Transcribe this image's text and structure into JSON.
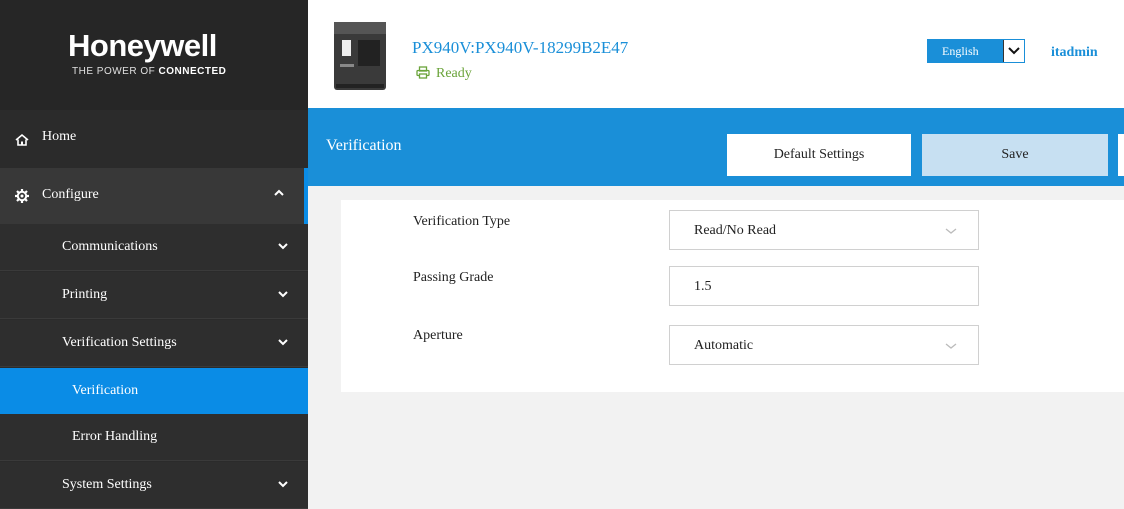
{
  "brand": {
    "name": "Honeywell",
    "tagline_a": "THE POWER OF ",
    "tagline_b": "CONNECTED"
  },
  "device": {
    "name": "PX940V:PX940V-18299B2E47",
    "status": "Ready"
  },
  "header": {
    "language": "English",
    "user": "itadmin"
  },
  "sidebar": {
    "home": "Home",
    "configure": "Configure",
    "items": [
      {
        "label": "Communications"
      },
      {
        "label": "Printing"
      },
      {
        "label": "Verification Settings"
      },
      {
        "label": "Verification"
      },
      {
        "label": "Error Handling"
      },
      {
        "label": "System Settings"
      }
    ]
  },
  "toolbar": {
    "title": "Verification",
    "default_label": "Default Settings",
    "save_label": "Save"
  },
  "form": {
    "verification_type": {
      "label": "Verification Type",
      "value": "Read/No Read"
    },
    "passing_grade": {
      "label": "Passing Grade",
      "value": "1.5"
    },
    "aperture": {
      "label": "Aperture",
      "value": "Automatic"
    }
  },
  "colors": {
    "accent": "#1a8fd8",
    "sidebar": "#2b2b2b",
    "status_green": "#6aa33a"
  }
}
